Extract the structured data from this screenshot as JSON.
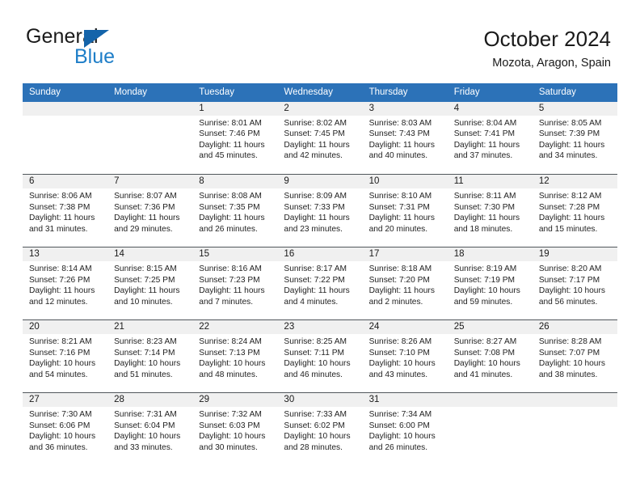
{
  "brand": {
    "word1": "General",
    "word2": "Blue",
    "triangle_color": "#1464aa",
    "word2_color": "#1e7ec8"
  },
  "header": {
    "title": "October 2024",
    "location": "Mozota, Aragon, Spain"
  },
  "theme": {
    "header_bg": "#2c72b8",
    "header_text": "#ffffff",
    "daynum_bg": "#f0f0f0",
    "cell_bg": "#ffffff",
    "grid_line": "#51575c",
    "body_text": "#222222"
  },
  "weekday_headers": [
    "Sunday",
    "Monday",
    "Tuesday",
    "Wednesday",
    "Thursday",
    "Friday",
    "Saturday"
  ],
  "labels": {
    "sunrise_prefix": "Sunrise:",
    "sunset_prefix": "Sunset:",
    "daylight_prefix": "Daylight:"
  },
  "weeks": [
    [
      {
        "day": "",
        "sunrise": "",
        "sunset": "",
        "daylight": "",
        "empty": true
      },
      {
        "day": "",
        "sunrise": "",
        "sunset": "",
        "daylight": "",
        "empty": true
      },
      {
        "day": "1",
        "sunrise": "Sunrise: 8:01 AM",
        "sunset": "Sunset: 7:46 PM",
        "daylight": "Daylight: 11 hours and 45 minutes."
      },
      {
        "day": "2",
        "sunrise": "Sunrise: 8:02 AM",
        "sunset": "Sunset: 7:45 PM",
        "daylight": "Daylight: 11 hours and 42 minutes."
      },
      {
        "day": "3",
        "sunrise": "Sunrise: 8:03 AM",
        "sunset": "Sunset: 7:43 PM",
        "daylight": "Daylight: 11 hours and 40 minutes."
      },
      {
        "day": "4",
        "sunrise": "Sunrise: 8:04 AM",
        "sunset": "Sunset: 7:41 PM",
        "daylight": "Daylight: 11 hours and 37 minutes."
      },
      {
        "day": "5",
        "sunrise": "Sunrise: 8:05 AM",
        "sunset": "Sunset: 7:39 PM",
        "daylight": "Daylight: 11 hours and 34 minutes."
      }
    ],
    [
      {
        "day": "6",
        "sunrise": "Sunrise: 8:06 AM",
        "sunset": "Sunset: 7:38 PM",
        "daylight": "Daylight: 11 hours and 31 minutes."
      },
      {
        "day": "7",
        "sunrise": "Sunrise: 8:07 AM",
        "sunset": "Sunset: 7:36 PM",
        "daylight": "Daylight: 11 hours and 29 minutes."
      },
      {
        "day": "8",
        "sunrise": "Sunrise: 8:08 AM",
        "sunset": "Sunset: 7:35 PM",
        "daylight": "Daylight: 11 hours and 26 minutes."
      },
      {
        "day": "9",
        "sunrise": "Sunrise: 8:09 AM",
        "sunset": "Sunset: 7:33 PM",
        "daylight": "Daylight: 11 hours and 23 minutes."
      },
      {
        "day": "10",
        "sunrise": "Sunrise: 8:10 AM",
        "sunset": "Sunset: 7:31 PM",
        "daylight": "Daylight: 11 hours and 20 minutes."
      },
      {
        "day": "11",
        "sunrise": "Sunrise: 8:11 AM",
        "sunset": "Sunset: 7:30 PM",
        "daylight": "Daylight: 11 hours and 18 minutes."
      },
      {
        "day": "12",
        "sunrise": "Sunrise: 8:12 AM",
        "sunset": "Sunset: 7:28 PM",
        "daylight": "Daylight: 11 hours and 15 minutes."
      }
    ],
    [
      {
        "day": "13",
        "sunrise": "Sunrise: 8:14 AM",
        "sunset": "Sunset: 7:26 PM",
        "daylight": "Daylight: 11 hours and 12 minutes."
      },
      {
        "day": "14",
        "sunrise": "Sunrise: 8:15 AM",
        "sunset": "Sunset: 7:25 PM",
        "daylight": "Daylight: 11 hours and 10 minutes."
      },
      {
        "day": "15",
        "sunrise": "Sunrise: 8:16 AM",
        "sunset": "Sunset: 7:23 PM",
        "daylight": "Daylight: 11 hours and 7 minutes."
      },
      {
        "day": "16",
        "sunrise": "Sunrise: 8:17 AM",
        "sunset": "Sunset: 7:22 PM",
        "daylight": "Daylight: 11 hours and 4 minutes."
      },
      {
        "day": "17",
        "sunrise": "Sunrise: 8:18 AM",
        "sunset": "Sunset: 7:20 PM",
        "daylight": "Daylight: 11 hours and 2 minutes."
      },
      {
        "day": "18",
        "sunrise": "Sunrise: 8:19 AM",
        "sunset": "Sunset: 7:19 PM",
        "daylight": "Daylight: 10 hours and 59 minutes."
      },
      {
        "day": "19",
        "sunrise": "Sunrise: 8:20 AM",
        "sunset": "Sunset: 7:17 PM",
        "daylight": "Daylight: 10 hours and 56 minutes."
      }
    ],
    [
      {
        "day": "20",
        "sunrise": "Sunrise: 8:21 AM",
        "sunset": "Sunset: 7:16 PM",
        "daylight": "Daylight: 10 hours and 54 minutes."
      },
      {
        "day": "21",
        "sunrise": "Sunrise: 8:23 AM",
        "sunset": "Sunset: 7:14 PM",
        "daylight": "Daylight: 10 hours and 51 minutes."
      },
      {
        "day": "22",
        "sunrise": "Sunrise: 8:24 AM",
        "sunset": "Sunset: 7:13 PM",
        "daylight": "Daylight: 10 hours and 48 minutes."
      },
      {
        "day": "23",
        "sunrise": "Sunrise: 8:25 AM",
        "sunset": "Sunset: 7:11 PM",
        "daylight": "Daylight: 10 hours and 46 minutes."
      },
      {
        "day": "24",
        "sunrise": "Sunrise: 8:26 AM",
        "sunset": "Sunset: 7:10 PM",
        "daylight": "Daylight: 10 hours and 43 minutes."
      },
      {
        "day": "25",
        "sunrise": "Sunrise: 8:27 AM",
        "sunset": "Sunset: 7:08 PM",
        "daylight": "Daylight: 10 hours and 41 minutes."
      },
      {
        "day": "26",
        "sunrise": "Sunrise: 8:28 AM",
        "sunset": "Sunset: 7:07 PM",
        "daylight": "Daylight: 10 hours and 38 minutes."
      }
    ],
    [
      {
        "day": "27",
        "sunrise": "Sunrise: 7:30 AM",
        "sunset": "Sunset: 6:06 PM",
        "daylight": "Daylight: 10 hours and 36 minutes."
      },
      {
        "day": "28",
        "sunrise": "Sunrise: 7:31 AM",
        "sunset": "Sunset: 6:04 PM",
        "daylight": "Daylight: 10 hours and 33 minutes."
      },
      {
        "day": "29",
        "sunrise": "Sunrise: 7:32 AM",
        "sunset": "Sunset: 6:03 PM",
        "daylight": "Daylight: 10 hours and 30 minutes."
      },
      {
        "day": "30",
        "sunrise": "Sunrise: 7:33 AM",
        "sunset": "Sunset: 6:02 PM",
        "daylight": "Daylight: 10 hours and 28 minutes."
      },
      {
        "day": "31",
        "sunrise": "Sunrise: 7:34 AM",
        "sunset": "Sunset: 6:00 PM",
        "daylight": "Daylight: 10 hours and 26 minutes."
      },
      {
        "day": "",
        "sunrise": "",
        "sunset": "",
        "daylight": "",
        "empty": true
      },
      {
        "day": "",
        "sunrise": "",
        "sunset": "",
        "daylight": "",
        "empty": true
      }
    ]
  ]
}
